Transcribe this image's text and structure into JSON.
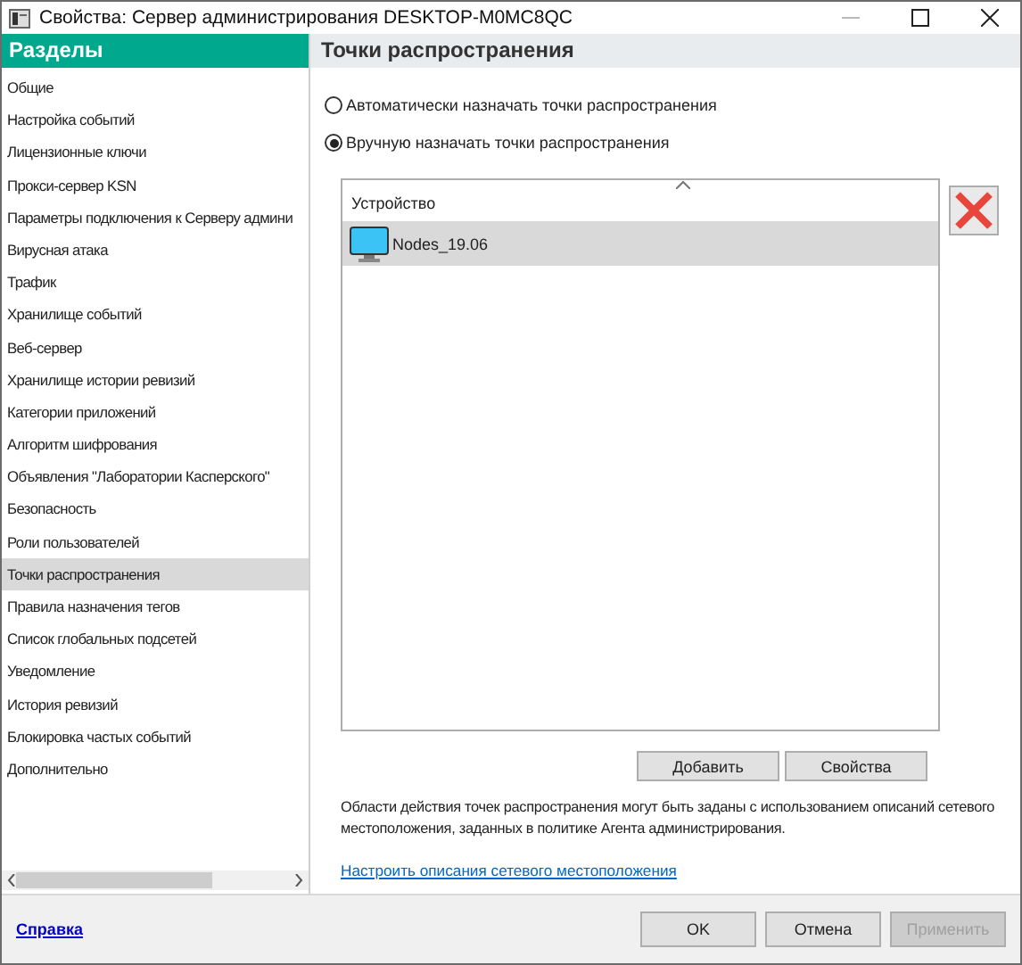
{
  "window": {
    "title": "Свойства: Сервер администрирования DESKTOP-M0MC8QC"
  },
  "sidebar": {
    "title": "Разделы",
    "items": [
      {
        "label": "Общие",
        "selected": false
      },
      {
        "label": "Настройка событий",
        "selected": false
      },
      {
        "label": "Лицензионные ключи",
        "selected": false
      },
      {
        "label": "Прокси-сервер KSN",
        "selected": false
      },
      {
        "label": "Параметры подключения к Серверу админи",
        "selected": false
      },
      {
        "label": "Вирусная атака",
        "selected": false
      },
      {
        "label": "Трафик",
        "selected": false
      },
      {
        "label": "Хранилище событий",
        "selected": false
      },
      {
        "label": "Веб-сервер",
        "selected": false
      },
      {
        "label": "Хранилище истории ревизий",
        "selected": false
      },
      {
        "label": "Категории приложений",
        "selected": false
      },
      {
        "label": "Алгоритм шифрования",
        "selected": false
      },
      {
        "label": "Объявления \"Лаборатории Касперского\"",
        "selected": false
      },
      {
        "label": "Безопасность",
        "selected": false
      },
      {
        "label": "Роли пользователей",
        "selected": false
      },
      {
        "label": "Точки распространения",
        "selected": true
      },
      {
        "label": "Правила назначения тегов",
        "selected": false
      },
      {
        "label": "Список глобальных подсетей",
        "selected": false
      },
      {
        "label": "Уведомление",
        "selected": false
      },
      {
        "label": "История ревизий",
        "selected": false
      },
      {
        "label": "Блокировка частых событий",
        "selected": false
      },
      {
        "label": "Дополнительно",
        "selected": false
      }
    ]
  },
  "section": {
    "title": "Точки распространения",
    "options": [
      {
        "label": "Автоматически назначать точки распространения",
        "selected": false
      },
      {
        "label": "Вручную назначать точки распространения",
        "selected": true
      }
    ],
    "table": {
      "columns": [
        "Устройство"
      ],
      "rows": [
        {
          "name": "Nodes_19.06",
          "selected": true
        }
      ]
    },
    "list_buttons": [
      "Добавить",
      "Свойства"
    ],
    "note": "Области действия точек распространения могут быть заданы с использованием описаний сетевого местоположения, заданных в политике Агента администрирования.",
    "link": "Настроить описания сетевого местоположения"
  },
  "help_link": "Справка",
  "footer_buttons": [
    {
      "label": "OK",
      "disabled": false
    },
    {
      "label": "Отмена",
      "disabled": false
    },
    {
      "label": "Применить",
      "disabled": true
    }
  ]
}
